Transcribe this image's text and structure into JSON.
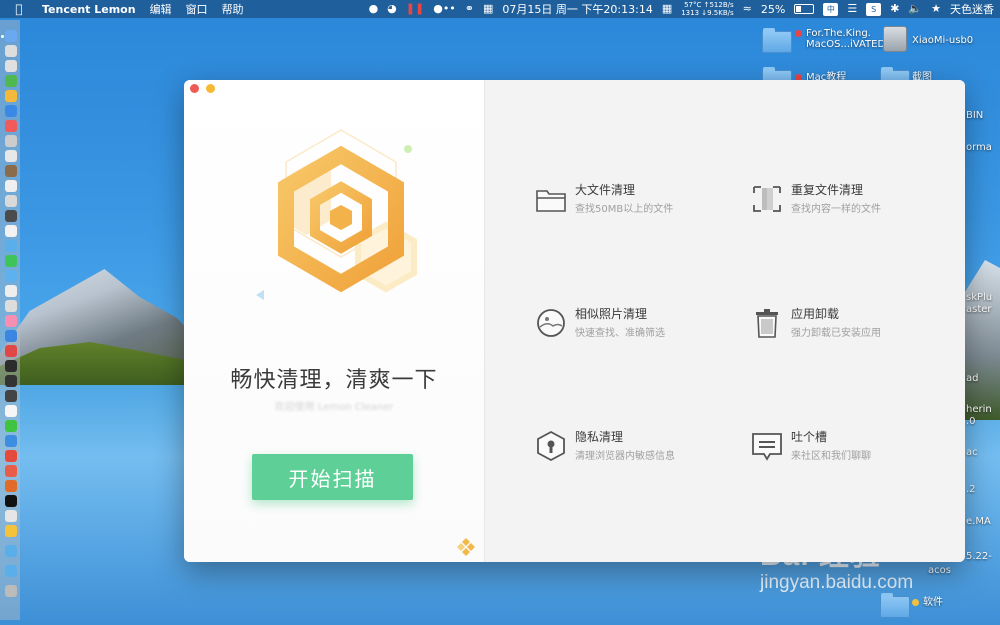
{
  "menubar": {
    "app_name": "Tencent Lemon",
    "menus": [
      "编辑",
      "窗口",
      "帮助"
    ],
    "datetime": "07月15日 周一 下午20:13:14",
    "net_top": "57°C ↑512B/s",
    "net_bottom": "1313 ↓9.5KB/s",
    "battery_percent": "25%",
    "input_method": "中",
    "user": "天色迷香"
  },
  "desktop": {
    "items": [
      {
        "label_line1": "For.The.King.",
        "label_line2": "MacOS...iVATED"
      },
      {
        "label_line1": "XiaoMi-usb0"
      },
      {
        "label_line1": "Mac教程"
      },
      {
        "label_line1": "截图"
      },
      {
        "label_line1": "软件"
      }
    ],
    "partial_labels": [
      "BIN",
      "orma",
      "skPlu",
      "aster",
      "ad",
      "herin",
      ".0",
      "ac",
      ".2",
      "e.MA",
      "5.22-",
      "acos"
    ]
  },
  "watermark": {
    "logo": "Bai 经验",
    "url": "jingyan.baidu.com"
  },
  "window": {
    "headline": "畅快清理，清爽一下",
    "subline": "欢迎使用 Lemon Cleaner",
    "scan_button": "开始扫描",
    "features": [
      {
        "title": "大文件清理",
        "desc": "查找50MB以上的文件",
        "icon": "folder-icon"
      },
      {
        "title": "重复文件清理",
        "desc": "查找内容一样的文件",
        "icon": "duplicate-file-icon"
      },
      {
        "title": "相似照片清理",
        "desc": "快速查找、准确筛选",
        "icon": "photo-icon"
      },
      {
        "title": "应用卸载",
        "desc": "强力卸载已安装应用",
        "icon": "trash-icon"
      },
      {
        "title": "隐私清理",
        "desc": "清理浏览器内敏感信息",
        "icon": "privacy-shield-icon"
      },
      {
        "title": "吐个槽",
        "desc": "来社区和我们聊聊",
        "icon": "feedback-icon"
      }
    ]
  },
  "colors": {
    "scan_button": "#5ecf96",
    "hex_orange": "#f2a93b",
    "close": "#ee5b55",
    "minimize": "#f5b935"
  }
}
